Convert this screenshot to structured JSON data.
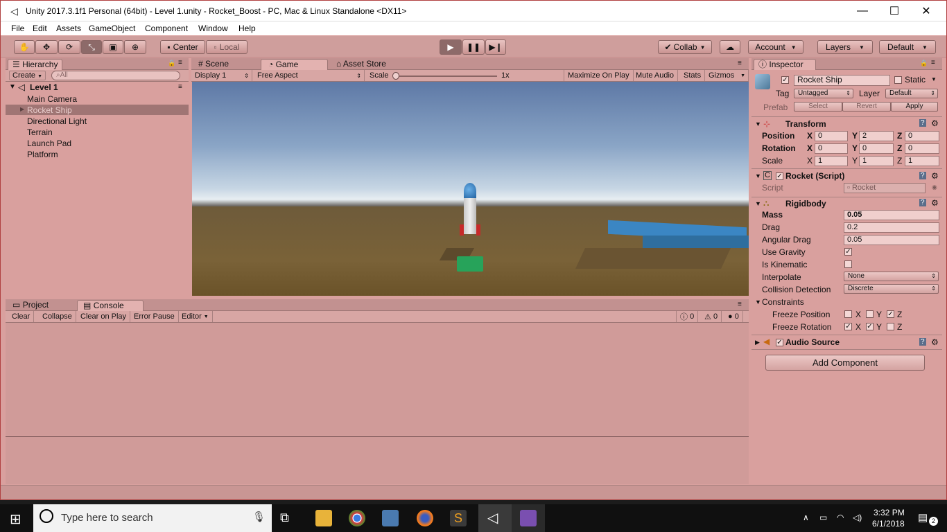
{
  "window": {
    "title": "Unity 2017.3.1f1 Personal (64bit) - Level 1.unity - Rocket_Boost - PC, Mac & Linux Standalone <DX11>"
  },
  "menu": [
    "File",
    "Edit",
    "Assets",
    "GameObject",
    "Component",
    "Window",
    "Help"
  ],
  "toolbar": {
    "center": "Center",
    "local": "Local",
    "collab": "Collab",
    "account": "Account",
    "layers": "Layers",
    "layout": "Default"
  },
  "hierarchy": {
    "tab": "Hierarchy",
    "create": "Create",
    "search_placeholder": "All",
    "scene": "Level 1",
    "items": [
      "Main Camera",
      "Rocket Ship",
      "Directional Light",
      "Terrain",
      "Launch Pad",
      "Platform"
    ]
  },
  "game": {
    "tabs": [
      "Scene",
      "Game",
      "Asset Store"
    ],
    "display": "Display 1",
    "aspect": "Free Aspect",
    "scale_label": "Scale",
    "scale_value": "1x",
    "toggles": [
      "Maximize On Play",
      "Mute Audio",
      "Stats",
      "Gizmos"
    ]
  },
  "console": {
    "tabs": [
      "Project",
      "Console"
    ],
    "buttons": [
      "Clear",
      "Collapse",
      "Clear on Play",
      "Error Pause",
      "Editor"
    ],
    "counts": {
      "info": "0",
      "warn": "0",
      "error": "0"
    }
  },
  "inspector": {
    "tab": "Inspector",
    "name": "Rocket Ship",
    "static": "Static",
    "tag_label": "Tag",
    "tag": "Untagged",
    "layer_label": "Layer",
    "layer": "Default",
    "prefab_label": "Prefab",
    "prefab_btns": [
      "Select",
      "Revert",
      "Apply"
    ],
    "transform": {
      "title": "Transform",
      "position_label": "Position",
      "position": [
        "0",
        "2",
        "0"
      ],
      "rotation_label": "Rotation",
      "rotation": [
        "0",
        "0",
        "0"
      ],
      "scale_label": "Scale",
      "scale": [
        "1",
        "1",
        "1"
      ]
    },
    "script": {
      "title": "Rocket (Script)",
      "label": "Script",
      "value": "Rocket"
    },
    "rigidbody": {
      "title": "Rigidbody",
      "mass_label": "Mass",
      "mass": "0.05",
      "drag_label": "Drag",
      "drag": "0.2",
      "angular_label": "Angular Drag",
      "angular": "0.05",
      "gravity_label": "Use Gravity",
      "kinematic_label": "Is Kinematic",
      "interpolate_label": "Interpolate",
      "interpolate": "None",
      "collision_label": "Collision Detection",
      "collision": "Discrete",
      "constraints_label": "Constraints",
      "freeze_pos_label": "Freeze Position",
      "freeze_rot_label": "Freeze Rotation",
      "axes": [
        "X",
        "Y",
        "Z"
      ]
    },
    "audio": {
      "title": "Audio Source"
    },
    "add_component": "Add Component"
  },
  "taskbar": {
    "search_placeholder": "Type here to search",
    "time": "3:32 PM",
    "date": "6/1/2018",
    "notifications": "2"
  },
  "colors": {
    "editor_tint": "#d9a09e",
    "sky": "#7f9bc0",
    "ground": "#7a6238",
    "platform": "#3b86c3",
    "launchpad": "#27a35a"
  }
}
